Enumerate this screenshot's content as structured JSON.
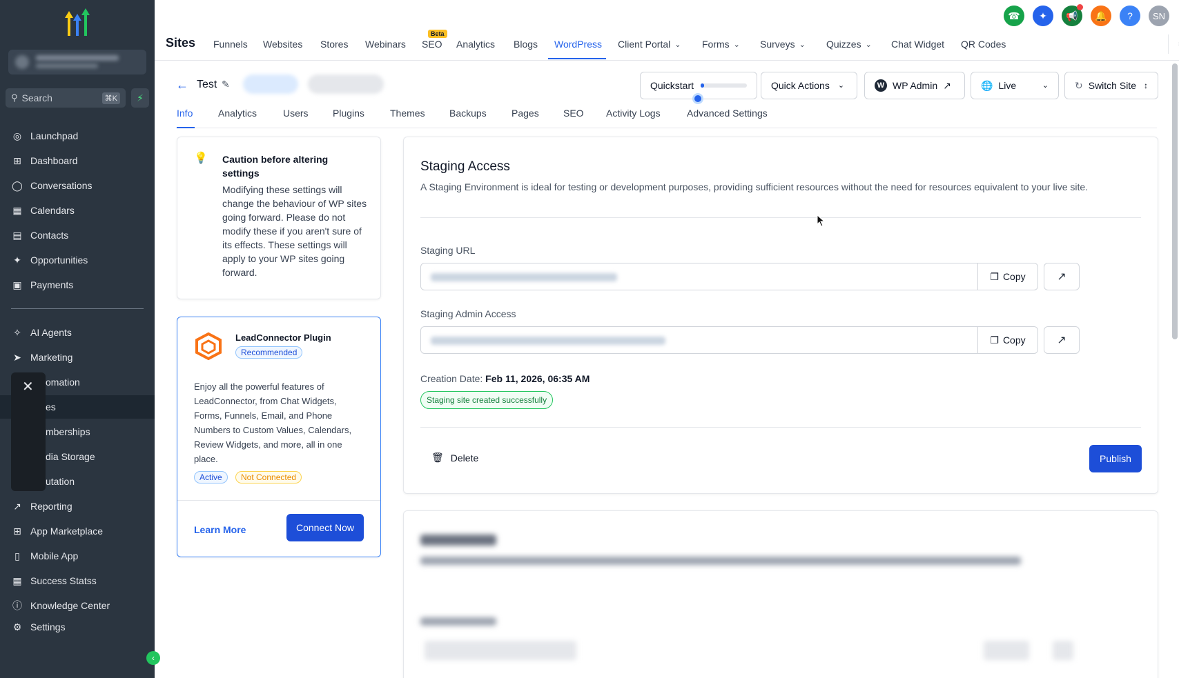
{
  "sidebar": {
    "search_label": "Search",
    "search_shortcut": "⌘K",
    "items_top": [
      {
        "label": "Launchpad",
        "icon": "launchpad-icon"
      },
      {
        "label": "Dashboard",
        "icon": "grid-icon"
      },
      {
        "label": "Conversations",
        "icon": "chat-icon"
      },
      {
        "label": "Calendars",
        "icon": "calendar-icon"
      },
      {
        "label": "Contacts",
        "icon": "contacts-icon"
      },
      {
        "label": "Opportunities",
        "icon": "opportunities-icon"
      },
      {
        "label": "Payments",
        "icon": "payments-icon"
      }
    ],
    "items_bottom": [
      {
        "label": "AI Agents",
        "icon": "ai-agents-icon"
      },
      {
        "label": "Marketing",
        "icon": "send-icon"
      },
      {
        "label": "omation",
        "icon": ""
      },
      {
        "label": "es",
        "icon": ""
      },
      {
        "label": "mberships",
        "icon": ""
      },
      {
        "label": "dia Storage",
        "icon": ""
      },
      {
        "label": "utation",
        "icon": ""
      },
      {
        "label": "Reporting",
        "icon": "trend-icon"
      },
      {
        "label": "App Marketplace",
        "icon": "apps-icon"
      },
      {
        "label": "Mobile App",
        "icon": "phone-icon"
      },
      {
        "label": "Success Statss",
        "icon": "stats-icon"
      },
      {
        "label": "Knowledge Center",
        "icon": "info-icon"
      }
    ],
    "settings_label": "Settings"
  },
  "topnav": {
    "title": "Sites",
    "tabs": [
      {
        "label": "Funnels"
      },
      {
        "label": "Websites"
      },
      {
        "label": "Stores"
      },
      {
        "label": "Webinars"
      },
      {
        "label": "SEO",
        "badge": "Beta"
      },
      {
        "label": "Analytics"
      },
      {
        "label": "Blogs"
      },
      {
        "label": "WordPress",
        "active": true
      },
      {
        "label": "Client Portal",
        "dropdown": true
      },
      {
        "label": "Forms",
        "dropdown": true
      },
      {
        "label": "Surveys",
        "dropdown": true
      },
      {
        "label": "Quizzes",
        "dropdown": true
      },
      {
        "label": "Chat Widget"
      },
      {
        "label": "QR Codes"
      }
    ],
    "avatar_initials": "SN",
    "colors": {
      "phone": "#16a34a",
      "ai": "#2563eb",
      "announce": "#15803d",
      "bell": "#f97316",
      "help": "#3b82f6",
      "avatar": "#9ca3af",
      "accent": "#2563eb"
    }
  },
  "site": {
    "name": "Test",
    "quickstart_label": "Quickstart",
    "quickstart_progress": 0.08,
    "quick_actions_label": "Quick Actions",
    "wp_admin_label": "WP Admin",
    "env_label": "Live",
    "switch_site_label": "Switch Site"
  },
  "subtabs": [
    "Info",
    "Analytics",
    "Users",
    "Plugins",
    "Themes",
    "Backups",
    "Pages",
    "SEO",
    "Activity Logs",
    "Advanced Settings"
  ],
  "caution": {
    "title": "Caution before altering settings",
    "body": "Modifying these settings will change the behaviour of WP sites going forward. Please do not modify these if you aren't sure of its effects. These settings will apply to your WP sites going forward."
  },
  "plugin": {
    "name": "LeadConnector Plugin",
    "recommended": "Recommended",
    "body": "Enjoy all the powerful features of LeadConnector, from Chat Widgets, Forms, Funnels, Email, and Phone Numbers to Custom Values, Calendars, Review Widgets, and more, all in one place.",
    "status_active": "Active",
    "status_not_connected": "Not Connected",
    "learn_more": "Learn More",
    "connect_now": "Connect Now"
  },
  "staging": {
    "title": "Staging Access",
    "description": "A Staging Environment is ideal for testing or development purposes, providing sufficient resources without the need for resources equivalent to your live site.",
    "url_label": "Staging URL",
    "admin_label": "Staging Admin Access",
    "copy_label": "Copy",
    "creation_label": "Creation Date:",
    "creation_value": "Feb 11, 2026, 06:35 AM",
    "success_badge": "Staging site created successfully",
    "delete_label": "Delete",
    "publish_label": "Publish"
  }
}
